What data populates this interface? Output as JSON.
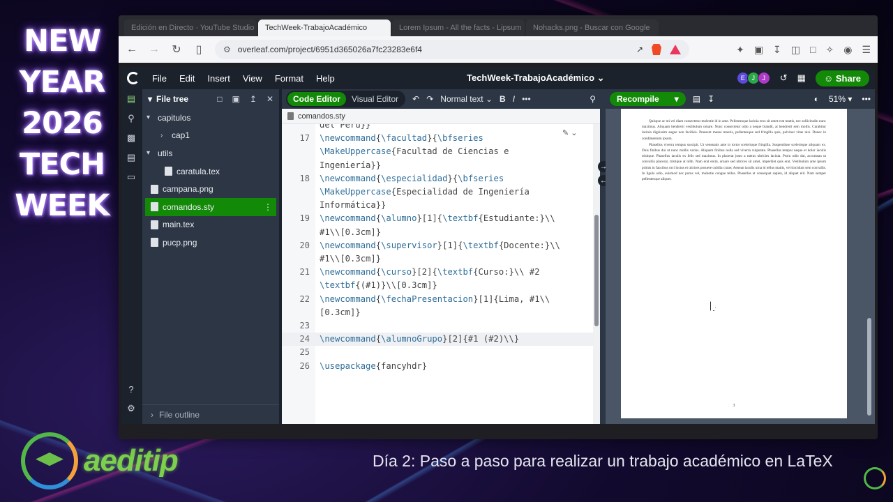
{
  "overlay": {
    "title_lines": [
      "NEW",
      "YEAR",
      "2026",
      "TECH",
      "WEEK"
    ],
    "brand": "aeditip",
    "caption": "Día 2: Paso a paso para realizar un trabajo académico en LaTeX"
  },
  "browser": {
    "tabs": [
      "Edición en Directo · YouTube Studio",
      "TechWeek-TrabajoAcadémico",
      "Lorem Ipsum - All the facts - Lipsum",
      "Nohacks.png - Buscar con Google"
    ],
    "url": "overleaf.com/project/6951d365026a7fc23283e6f4",
    "brave_badge": "1"
  },
  "menubar": {
    "items": [
      "File",
      "Edit",
      "Insert",
      "View",
      "Format",
      "Help"
    ],
    "project_title": "TechWeek-TrabajoAcadémico",
    "avatars": [
      "E",
      "J",
      "J"
    ],
    "share_label": "Share"
  },
  "file_tree": {
    "title": "File tree",
    "items": [
      {
        "label": "capitulos",
        "type": "folder",
        "open": true,
        "depth": 0
      },
      {
        "label": "cap1",
        "type": "folder",
        "open": false,
        "depth": 1
      },
      {
        "label": "utils",
        "type": "folder",
        "open": true,
        "depth": 0
      },
      {
        "label": "caratula.tex",
        "type": "file",
        "depth": 1
      },
      {
        "label": "campana.png",
        "type": "file",
        "depth": 0
      },
      {
        "label": "comandos.sty",
        "type": "file",
        "depth": 0,
        "selected": true
      },
      {
        "label": "main.tex",
        "type": "file",
        "depth": 0
      },
      {
        "label": "pucp.png",
        "type": "file",
        "depth": 0
      }
    ],
    "outline_label": "File outline"
  },
  "editor": {
    "mode_code": "Code Editor",
    "mode_visual": "Visual Editor",
    "text_style": "Normal text",
    "bold": "B",
    "italic": "I",
    "more": "•••",
    "open_file": "comandos.sty",
    "lines": [
      {
        "num": "",
        "text": "del Perú}}"
      },
      {
        "num": "17",
        "text": "\\newcommand{\\facultad}{\\bfseries"
      },
      {
        "num": "",
        "text": "\\MakeUppercase{Facultad de Ciencias e"
      },
      {
        "num": "",
        "text": "Ingeniería}}"
      },
      {
        "num": "18",
        "text": "\\newcommand{\\especialidad}{\\bfseries"
      },
      {
        "num": "",
        "text": "\\MakeUppercase{Especialidad de Ingeniería"
      },
      {
        "num": "",
        "text": "Informática}}"
      },
      {
        "num": "19",
        "text": "\\newcommand{\\alumno}[1]{\\textbf{Estudiante:}\\\\"
      },
      {
        "num": "",
        "text": "#1\\\\[0.3cm]}"
      },
      {
        "num": "20",
        "text": "\\newcommand{\\supervisor}[1]{\\textbf{Docente:}\\\\"
      },
      {
        "num": "",
        "text": "#1\\\\[0.3cm]}"
      },
      {
        "num": "21",
        "text": "\\newcommand{\\curso}[2]{\\textbf{Curso:}\\\\ #2"
      },
      {
        "num": "",
        "text": "\\textbf{(#1)}\\\\[0.3cm]}"
      },
      {
        "num": "22",
        "text": "\\newcommand{\\fechaPresentacion}[1]{Lima, #1\\\\"
      },
      {
        "num": "",
        "text": "[0.3cm]}"
      },
      {
        "num": "23",
        "text": ""
      },
      {
        "num": "24",
        "text": "\\newcommand{\\alumnoGrupo}[2]{#1 (#2)\\\\}",
        "current": true
      },
      {
        "num": "25",
        "text": ""
      },
      {
        "num": "26",
        "text": "\\usepackage{fancyhdr}"
      }
    ]
  },
  "pdf": {
    "recompile_label": "Recompile",
    "zoom": "51%",
    "paragraphs": [
      "Quisque ac mi vel diam consectetur molestie id in ante. Pellentesque lacinia eros sit amet erat mattis, nec sollicitudin nunc maximus. Aliquam hendrerit vestibulum ornare. Nunc consectetur odio a neque blandit, at hendrerit sem mollis. Curabitur lacinia dignissim augue non facilisis. Praesent massa mauris, pellentesque sed fringilla quis, pulvinar vitae nisi. Donec in condimentum ipsum.",
      "Phasellus viverra tempus suscipit. Ut venenatis ante in tortor scelerisque fringilla. Suspendisse scelerisque aliquam ex. Duis finibus dui ut nunc mollis varius. Aliquam finibus nulla sed viverra vulputate. Phasellus tempor neque et dolor iaculis tristique. Phasellus iaculis ex felis sed maximus. In placerat justo a metus ultricies lacinia. Proin odio dui, accumsan ut convallis placerat, tristique at nibh. Nam erat enim, ornare sed ultrices sit amet, imperdiet quis erat. Vestibulum ante ipsum primis in faucibus orci luctus et ultrices posuere cubilia curae; Aenean iaculis urna id tellus mattis, vel tincidunt sem convallis. In ligula odio, euismod nec purus vel, molestie congue tellus. Phasellus et consequat sapien, id aliquet elit. Nam semper pellentesque aliquet."
    ],
    "page_number": "3"
  },
  "icons": {
    "back": "arrow-left-icon",
    "forward": "arrow-right-icon",
    "reload": "reload-icon"
  },
  "colors": {
    "accent_green": "#138a07",
    "panel_dark": "#1b222c",
    "panel_mid": "#2c3645"
  }
}
